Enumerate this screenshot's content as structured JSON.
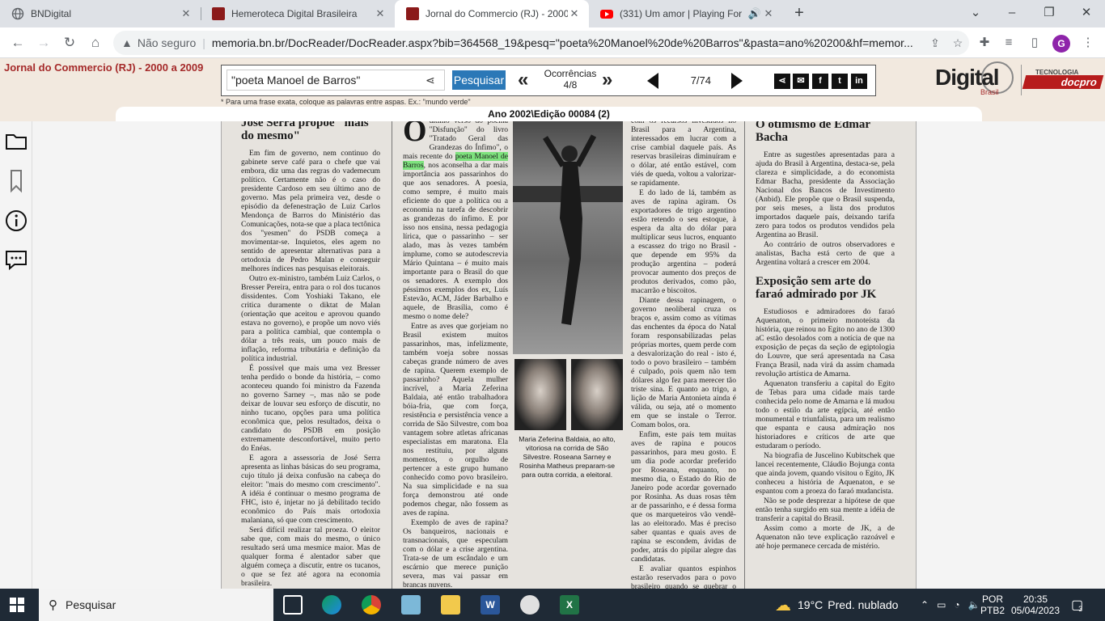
{
  "browser": {
    "tabs": [
      {
        "title": "BNDigital",
        "icon": "globe-icon",
        "active": false
      },
      {
        "title": "Hemeroteca Digital Brasileira",
        "icon": "bn-logo-icon",
        "active": false
      },
      {
        "title": "Jornal do Commercio (RJ) - 2000",
        "icon": "bn-logo-icon",
        "active": true
      },
      {
        "title": "(331) Um amor | Playing For",
        "icon": "youtube-icon",
        "active": false
      }
    ],
    "new_tab": "+",
    "security_label": "Não seguro",
    "url": "memoria.bn.br/DocReader/DocReader.aspx?bib=364568_19&pesq=\"poeta%20Manoel%20de%20Barros\"&pasta=ano%20200&hf=memor...",
    "profile_initial": "G",
    "profile_color": "#8e24aa"
  },
  "site": {
    "journal_title": "Jornal do Commercio (RJ) - 2000 a 2009",
    "search_value": "\"poeta Manoel de Barros\"",
    "search_button": "Pesquisar",
    "occurrences_label": "Ocorrências",
    "occurrences_value": "4/8",
    "page_current": "7",
    "page_total": "/74",
    "hint": "* Para uma frase exata, coloque as palavras entre aspas. Ex.: \"mundo verde\"",
    "edition": "Ano 2002\\Edição 00084 (2)",
    "logo_word": "Digital",
    "logo_sub": "Brasil",
    "logo_tech": "TECNOLOGIA",
    "logo_docpro": "docpro",
    "accent": "#a52a2a",
    "button_color": "#2b78b7"
  },
  "article": {
    "col1_headline": "José Serra propõe \"mais do mesmo\"",
    "col1_p1": "Em fim de governo, nem continuo do gabinete serve café para o chefe que vai embora, diz uma das regras do vademecum político. Certamente não é o caso do presidente Cardoso em seu último ano de governo. Mas pela primeira vez, desde o episódio da defenestração de Luiz Carlos Mendonça de Barros do Ministério das Comunicações, nota-se que a placa tectônica dos \"yesmen\" do PSDB começa a movimentar-se. Inquietos, eles agem no sentido de apresentar alternativas para a ortodoxia de Pedro Malan e conseguir melhores índices nas pesquisas eleitorais.",
    "col1_p2": "Outro ex-ministro, também Luiz Carlos, o Bresser Pereira, entra para o rol dos tucanos dissidentes. Com Yoshiaki Takano, ele critica duramente o diktat de Malan (orientação que aceitou e aprovou quando estava no governo), e propõe um novo viés para a política cambial, que contempla o dólar a três reais, um pouco mais de inflação, reforma tributária e definição da política industrial.",
    "col1_p3": "É possível que mais uma vez Bresser tenha perdido o bonde da história, – como aconteceu quando foi ministro da Fazenda no governo Sarney –, mas não se pode deixar de louvar seu esforço de discutir, no ninho tucano, opções para uma política econômica que, pelos resultados, deixa o candidato do PSDB em posição extremamente desconfortável, muito perto do Enéas.",
    "col1_p4": "E agora a assessoria de José Serra apresenta as linhas básicas do seu programa, cujo título já deixa confusão na cabeça do eleitor: \"mais do mesmo com crescimento\". A idéia é continuar o mesmo programa de FHC, isto é, injetar no já debilitado tecido econômico do País mais ortodoxia malaniana, só que com crescimento.",
    "col1_p5": "Será difícil realizar tal proeza. O eleitor sabe que, com mais do mesmo, o único resultado será uma mesmice maior. Mas de qualquer forma é alentador saber que alguém começa a discutir, entre os tucanos, o que se fez até agora na economia brasileira.",
    "col2_dropcap": "O",
    "col2_p1_a": "último verso do poema \"Disfunção\" do livro \"Tratado Geral das Grandezas do Ínfimo\", o mais recente do",
    "col2_hl1": "poeta Manoel de",
    "col2_hl2": "Barros",
    "col2_p1_b": ", nos aconselha a dar mais importância aos passarinhos do que aos senadores. A poesia, como sempre, é muito mais eficiente do que a política ou a economia na tarefa de descobrir as grandezas do ínfimo. E por isso nos ensina, nessa pedagogia lírica, que o passarinho – ser alado, mas às vezes também implume, como se autodescrevia Mário Quintana – é muito mais importante para o Brasil do que os senadores. A exemplo dos péssimos exemplos dos ex, Luís Estevão, ACM, Jáder Barbalho e aquele, de Brasília, como é mesmo o nome dele?",
    "col2_p2": "Entre as aves que gorjeiam no Brasil existem muitos passarinhos, mas, infelizmente, também voeja sobre nossas cabeças grande número de aves de rapina. Querem exemplo de passarinho? Aquela mulher incrível, a Maria Zeferina Baldaia, até então trabalhadora bóia-fria, que com força, resistência e persistência vence a corrida de São Silvestre, com boa vantagem sobre atletas africanas especialistas em maratona. Ela nos restituiu, por alguns momentos, o orgulho de pertencer a este grupo humano conhecido como povo brasileiro. Na sua simplicidade e na sua força demonstrou até onde podemos chegar, não fossem as aves de rapina.",
    "col2_p3": "Exemplo de aves de rapina? Os banqueiros, nacionais e transnacionais, que especulam com o dólar e a crise argentina. Trata-se de um escândalo e um escárnio que merece punição severa, mas vai passar em brancas nuvens.",
    "caption": "Maria Zeferina Baldaia, ao alto, vitoriosa na corrida de São Silvestre. Roseana Sarney e Rosinha Matheus preparam-se para outra corrida, a eleitoral.",
    "col3_p1": "com os recursos investidos no Brasil para a Argentina, interessados em lucrar com a crise cambial daquele país. As reservas brasileiras diminuíram e o dólar, até então estável, com viés de queda, voltou a valorizar-se rapidamente.",
    "col3_p2": "E do lado de lá, também as aves de rapina agiram. Os exportadores de trigo argentino estão retendo o seu estoque, à espera da alta do dólar para multiplicar seus lucros, enquanto a escassez do trigo no Brasil - que depende em 95% da produção argentina – poderá provocar aumento dos preços de produtos derivados, como pão, macarrão e biscoitos.",
    "col3_p3": "Diante dessa rapinagem, o governo neoliberal cruza os braços e, assim como as vítimas das enchentes da época do Natal foram responsabilizadas pelas próprias mortes, quem perde com a desvalorização do real - isto é, todo o povo brasileiro – também é culpado, pois quem não tem dólares algo fez para merecer tão triste sina. E quanto ao trigo, a lição de Maria Antonieta ainda é válida, ou seja, até o momento em que se instale o Terror. Comam bolos, ora.",
    "col3_p4": "Enfim, este país tem muitas aves de rapina e poucos passarinhos, para meu gosto. E um dia pode acordar preferido por Roseana, enquanto, no mesmo dia, o Estado do Rio de Janeiro pode acordar governado por Rosinha. As duas rosas têm ar de passarinho, e é dessa forma que os marqueteiros vão vendê-las ao eleitorado. Mas é preciso saber quantas e quais aves de rapina se escondem, ávidas de poder, atrás do pipilar alegre das candidatas.",
    "col3_p5": "E avaliar quantos espinhos estarão reservados para o povo brasileiro quando se quebrar o encanto.",
    "col4_headline1": "O otimismo de Edmar Bacha",
    "col4_p1": "Entre as sugestões apresentadas para a ajuda do Brasil à Argentina, destaca-se, pela clareza e simplicidade, a do economista Edmar Bacha, presidente da Associação Nacional dos Bancos de Investimento (Anbid). Ele propõe que o Brasil suspenda, por seis meses, a lista dos produtos importados daquele país, deixando tarifa zero para todos os produtos vendidos pela Argentina ao Brasil.",
    "col4_p2": "Ao contrário de outros observadores e analistas, Bacha está certo de que a Argentina voltará a crescer em 2004.",
    "col4_headline2": "Exposição sem arte do faraó admirado por JK",
    "col4_p3": "Estudiosos e admiradores do faraó Aquenaton, o primeiro monoteísta da história, que reinou no Egito no ano de 1300 aC estão desolados com a notícia de que na exposição de peças da seção de egiptologia do Louvre, que será apresentada na Casa França Brasil, nada virá da assim chamada revolução artística de Amarna.",
    "col4_p4": "Aquenaton transferiu a capital do Egito de Tebas para uma cidade mais tarde conhecida pelo nome de Amarna e lá mudou todo o estilo da arte egípcia, até então monumental e triunfalista, para um realismo que espanta e causa admiração nos historiadores e críticos de arte que estudaram o período.",
    "col4_p5": "Na biografia de Juscelino Kubitschek que lancei recentemente, Cláudio Bojunga conta que ainda jovem, quando visitou o Egito, JK conheceu a história de Aquenaton, e se espantou com a proeza do faraó mudancista.",
    "col4_p6": "Não se pode desprezar a hipótese de que então tenha surgido em sua mente a idéia de transferir a capital do Brasil.",
    "col4_p7": "Assim como a morte de JK, a de Aquenaton não teve explicação razoável e até hoje permanece cercada de mistério."
  },
  "taskbar": {
    "search_placeholder": "Pesquisar",
    "weather_temp": "19°C",
    "weather_text": "Pred. nublado",
    "lang1": "POR",
    "lang2": "PTB2",
    "time": "20:35",
    "date": "05/04/2023",
    "notifications": "3"
  }
}
